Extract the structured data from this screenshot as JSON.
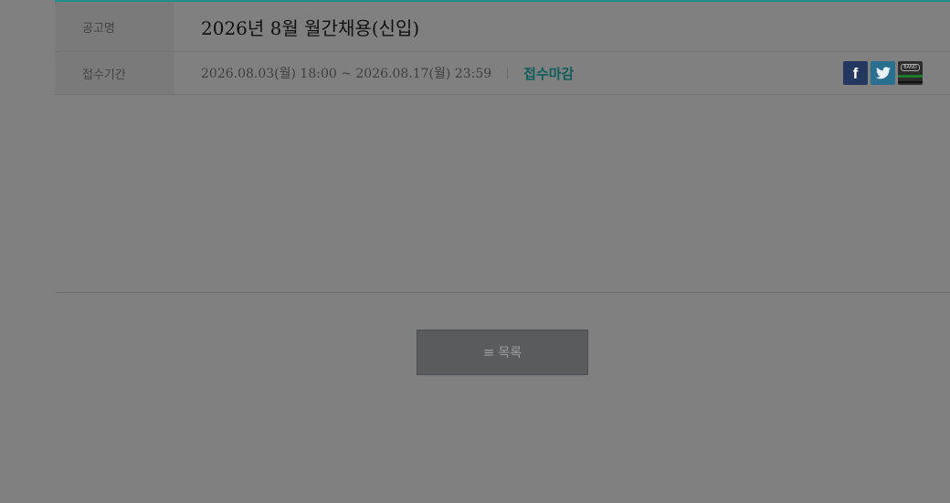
{
  "detail": {
    "title_label": "공고명",
    "title_value": "2026년 8월 월간채용(신입)",
    "period_label": "접수기간",
    "period_value": "2026.08.03(월) 18:00 ~ 2026.08.17(월) 23:59",
    "status": "접수마감"
  },
  "share": {
    "facebook_glyph": "f",
    "band_text": "BAND"
  },
  "footer": {
    "list_icon": "≡",
    "list_label": "목록"
  },
  "colors": {
    "accent": "#1e8f8a",
    "status": "#0f5e5b",
    "facebook": "#24375e",
    "twitter": "#2b6f90",
    "band": "#1c7a2c"
  }
}
